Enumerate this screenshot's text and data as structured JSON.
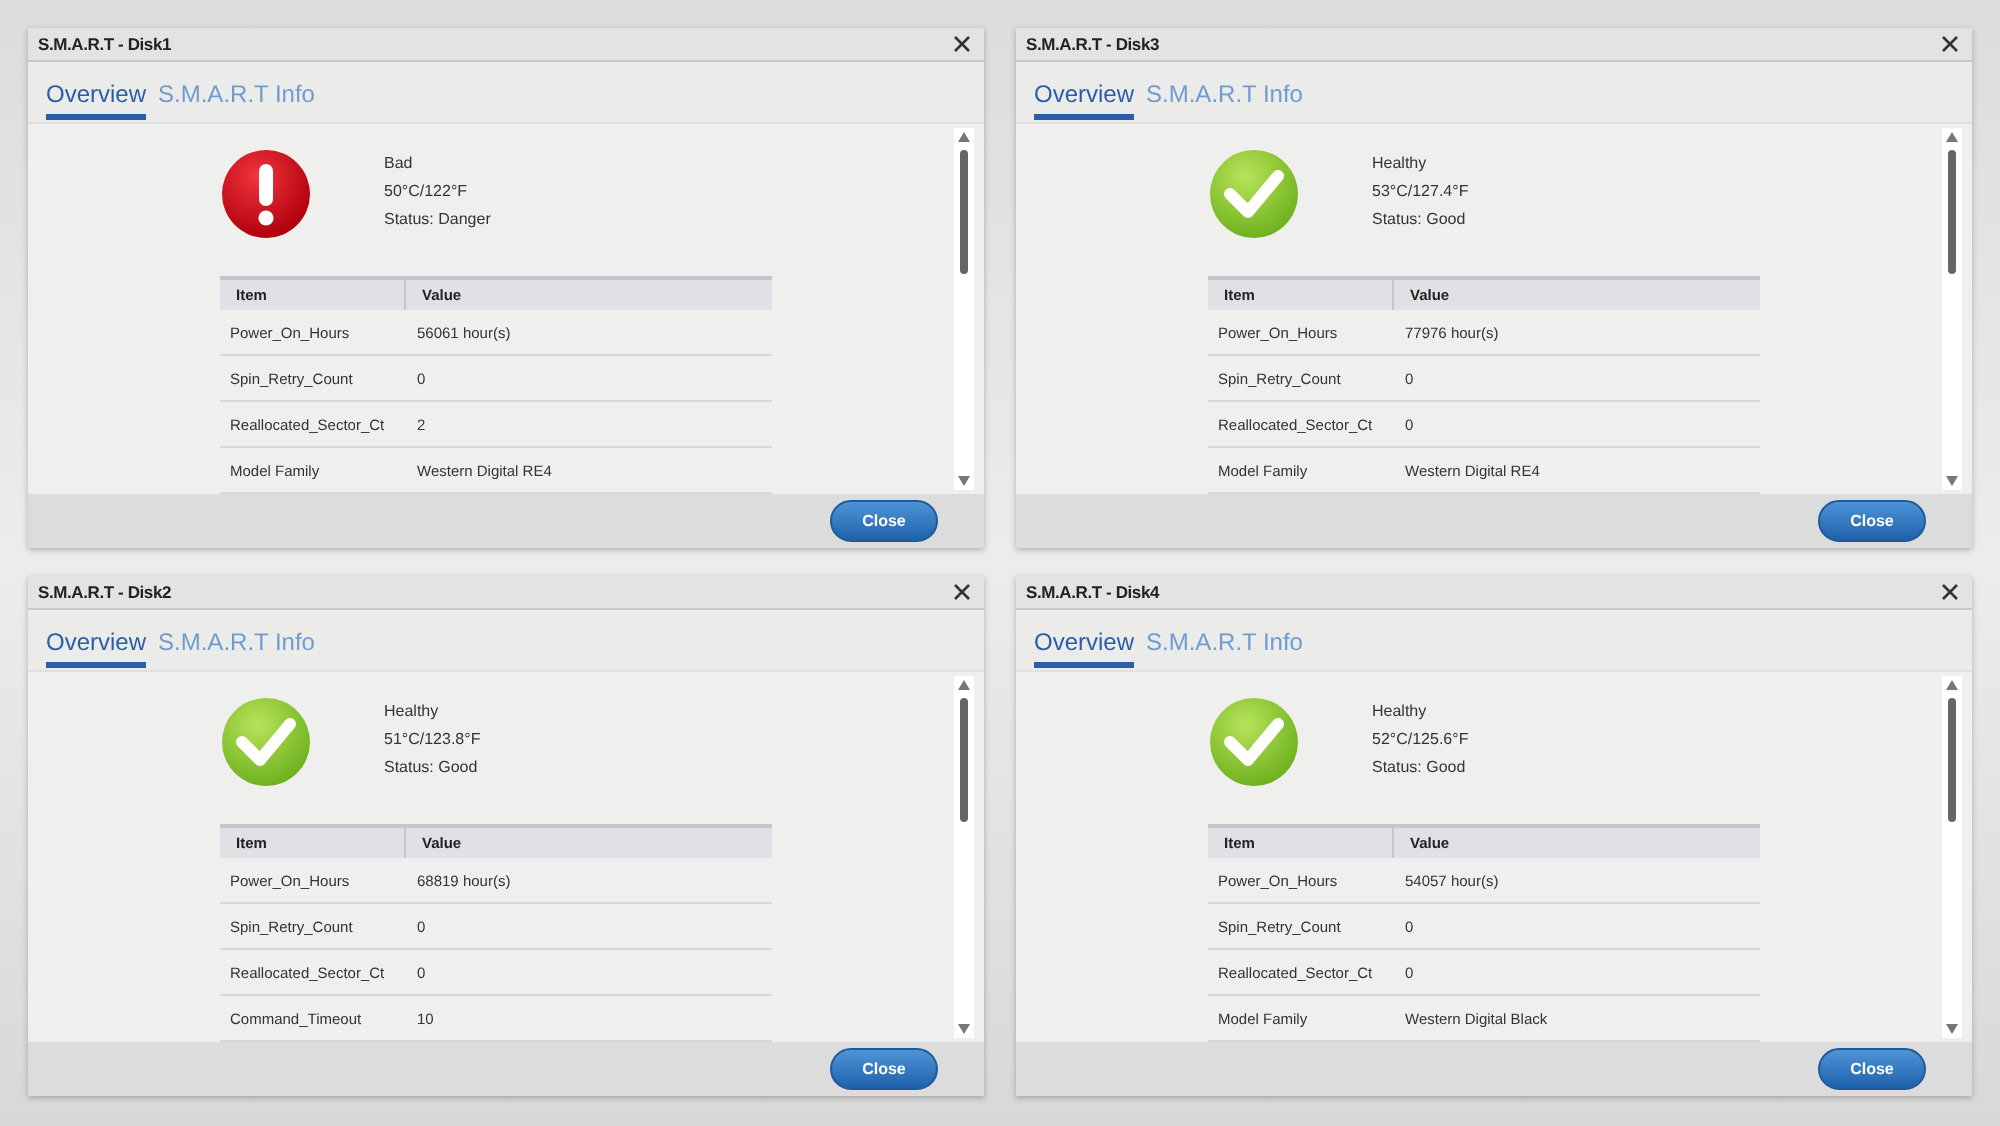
{
  "dialogs": [
    {
      "title": "S.M.A.R.T - Disk1",
      "tabs": [
        {
          "label": "Overview",
          "selected": true
        },
        {
          "label": "S.M.A.R.T Info",
          "selected": false
        }
      ],
      "health": {
        "kind": "danger",
        "lines": [
          "Bad",
          "50°C/122°F",
          "Status: Danger"
        ]
      },
      "table": {
        "columns": [
          "Item",
          "Value"
        ],
        "rows": [
          [
            "Power_On_Hours",
            "56061 hour(s)"
          ],
          [
            "Spin_Retry_Count",
            "0"
          ],
          [
            "Reallocated_Sector_Ct",
            "2"
          ],
          [
            "Model Family",
            "Western Digital RE4"
          ]
        ]
      },
      "close_button": "Close"
    },
    {
      "title": "S.M.A.R.T - Disk3",
      "tabs": [
        {
          "label": "Overview",
          "selected": true
        },
        {
          "label": "S.M.A.R.T Info",
          "selected": false
        }
      ],
      "health": {
        "kind": "good",
        "lines": [
          "Healthy",
          "53°C/127.4°F",
          "Status: Good"
        ]
      },
      "table": {
        "columns": [
          "Item",
          "Value"
        ],
        "rows": [
          [
            "Power_On_Hours",
            "77976 hour(s)"
          ],
          [
            "Spin_Retry_Count",
            "0"
          ],
          [
            "Reallocated_Sector_Ct",
            "0"
          ],
          [
            "Model Family",
            "Western Digital RE4"
          ]
        ]
      },
      "close_button": "Close"
    },
    {
      "title": "S.M.A.R.T - Disk2",
      "tabs": [
        {
          "label": "Overview",
          "selected": true
        },
        {
          "label": "S.M.A.R.T Info",
          "selected": false
        }
      ],
      "health": {
        "kind": "good",
        "lines": [
          "Healthy",
          "51°C/123.8°F",
          "Status: Good"
        ]
      },
      "table": {
        "columns": [
          "Item",
          "Value"
        ],
        "rows": [
          [
            "Power_On_Hours",
            "68819 hour(s)"
          ],
          [
            "Spin_Retry_Count",
            "0"
          ],
          [
            "Reallocated_Sector_Ct",
            "0"
          ],
          [
            "Command_Timeout",
            "10"
          ]
        ]
      },
      "close_button": "Close"
    },
    {
      "title": "S.M.A.R.T - Disk4",
      "tabs": [
        {
          "label": "Overview",
          "selected": true
        },
        {
          "label": "S.M.A.R.T Info",
          "selected": false
        }
      ],
      "health": {
        "kind": "good",
        "lines": [
          "Healthy",
          "52°C/125.6°F",
          "Status: Good"
        ]
      },
      "table": {
        "columns": [
          "Item",
          "Value"
        ],
        "rows": [
          [
            "Power_On_Hours",
            "54057 hour(s)"
          ],
          [
            "Spin_Retry_Count",
            "0"
          ],
          [
            "Reallocated_Sector_Ct",
            "0"
          ],
          [
            "Model Family",
            "Western Digital Black"
          ]
        ]
      },
      "close_button": "Close"
    }
  ]
}
